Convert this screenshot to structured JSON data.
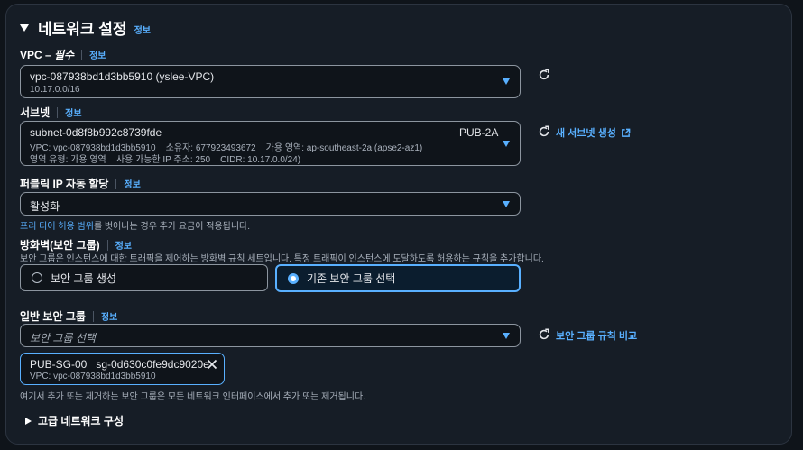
{
  "section": {
    "title": "네트워크 설정",
    "info": "정보"
  },
  "vpc": {
    "label_prefix": "VPC – ",
    "label_required": "필수",
    "info": "정보",
    "value": "vpc-087938bd1d3bb5910 (yslee-VPC)",
    "cidr": "10.17.0.0/16"
  },
  "subnet": {
    "label": "서브넷",
    "info": "정보",
    "value": "subnet-0d8f8b992c8739fde",
    "name": "PUB-2A",
    "detail1": "VPC: vpc-087938bd1d3bb5910    소유자: 677923493672    가용 영역: ap-southeast-2a (apse2-az1)",
    "detail2": "영역 유형: 가용 영역    사용 가능한 IP 주소: 250    CIDR: 10.17.0.0/24)",
    "create_link": "새 서브넷 생성"
  },
  "public_ip": {
    "label": "퍼블릭 IP 자동 할당",
    "info": "정보",
    "value": "활성화",
    "note_link": "프리 티어 허용 범위",
    "note_rest": "를 벗어나는 경우 추가 요금이 적용됩니다."
  },
  "firewall": {
    "label": "방화벽(보안 그룹)",
    "info": "정보",
    "description": "보안 그룹은 인스턴스에 대한 트래픽을 제어하는 방화벽 규칙 세트입니다. 특정 트래픽이 인스턴스에 도달하도록 허용하는 규칙을 추가합니다.",
    "option_create": "보안 그룹 생성",
    "option_existing": "기존 보안 그룹 선택",
    "selected": "기존 보안 그룹 선택"
  },
  "common_sg": {
    "label": "일반 보안 그룹",
    "info": "정보",
    "placeholder": "보안 그룹 선택",
    "compare_link": "보안 그룹 규칙 비교",
    "token_name": "PUB-SG-00",
    "token_id": "sg-0d630c0fe9dc9020e",
    "token_vpc": "VPC: vpc-087938bd1d3bb5910",
    "note": "여기서 추가 또는 제거하는 보안 그룹은 모든 네트워크 인터페이스에서 추가 또는 제거됩니다."
  },
  "advanced": {
    "label": "고급 네트워크 구성"
  },
  "colors": {
    "link": "#59b0ff",
    "background": "#0f141a",
    "panel": "#161d26",
    "selected_card": "#0b1d2e"
  },
  "icons": [
    "caret-down-icon",
    "refresh-icon",
    "external-link-icon",
    "close-icon",
    "caret-right-icon"
  ]
}
